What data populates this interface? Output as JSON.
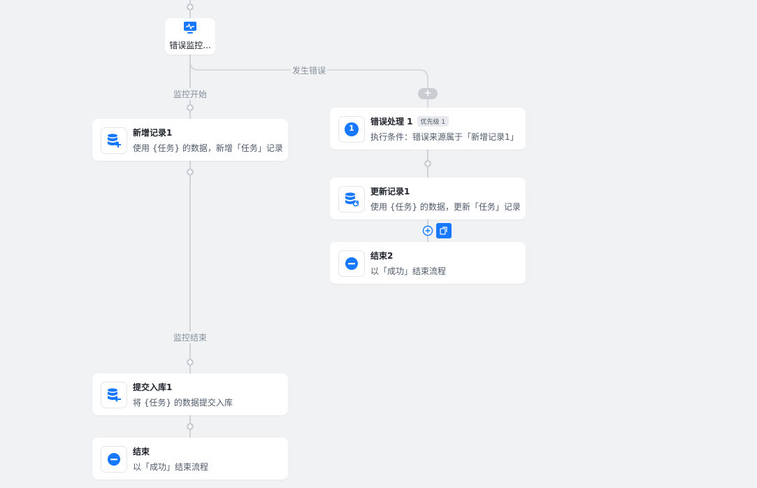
{
  "monitor": {
    "title": "错误监控..."
  },
  "edges": {
    "error": "发生错误",
    "monitor_start": "监控开始",
    "monitor_end": "监控结束"
  },
  "nodes": {
    "add_record": {
      "title": "新增记录1",
      "desc": "使用 {任务} 的数据，新增「任务」记录"
    },
    "commit": {
      "title": "提交入库1",
      "desc": "将 {任务} 的数据提交入库"
    },
    "end": {
      "title": "结束",
      "desc": "以「成功」结束流程"
    },
    "error_handler": {
      "title": "错误处理 1",
      "badge": "优先级 1",
      "desc": "执行条件：错误来源属于「新增记录1」",
      "number": "1"
    },
    "update_record": {
      "title": "更新记录1",
      "desc": "使用 {任务} 的数据，更新「任务」记录"
    },
    "end2": {
      "title": "结束2",
      "desc": "以「成功」结束流程"
    }
  },
  "colors": {
    "accent": "#1677ff",
    "line": "#cfd2d7",
    "background": "#f1f2f4"
  }
}
